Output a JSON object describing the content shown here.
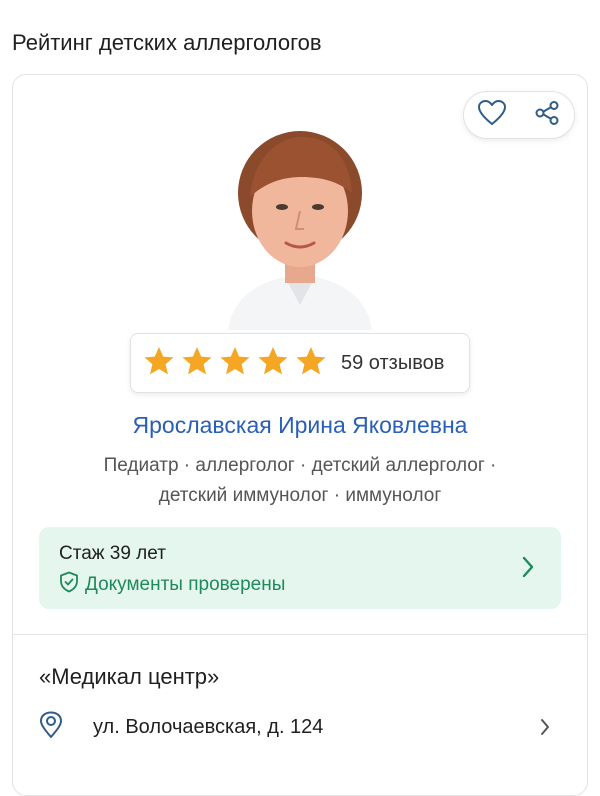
{
  "page": {
    "title": "Рейтинг детских аллергологов"
  },
  "doctor": {
    "rating": 5,
    "reviews": "59 отзывов",
    "name": "Ярославская Ирина Яковлевна",
    "specialties_line1": "Педиатр · аллерголог · детский аллерголог ·",
    "specialties_line2": "детский иммунолог · иммунолог"
  },
  "experience": {
    "text": "Стаж 39 лет",
    "docs": "Документы проверены"
  },
  "clinic": {
    "name": "«Медикал центр»",
    "address": "ул. Волочаевская, д. 124"
  },
  "colors": {
    "accent_blue": "#2a5fb8",
    "star": "#f5a623",
    "green": "#1f8a5b",
    "green_bg": "#e4f6ee"
  },
  "icons": [
    "heart-icon",
    "share-icon",
    "star-icon",
    "shield-check-icon",
    "chevron-right-icon",
    "location-pin-icon"
  ]
}
